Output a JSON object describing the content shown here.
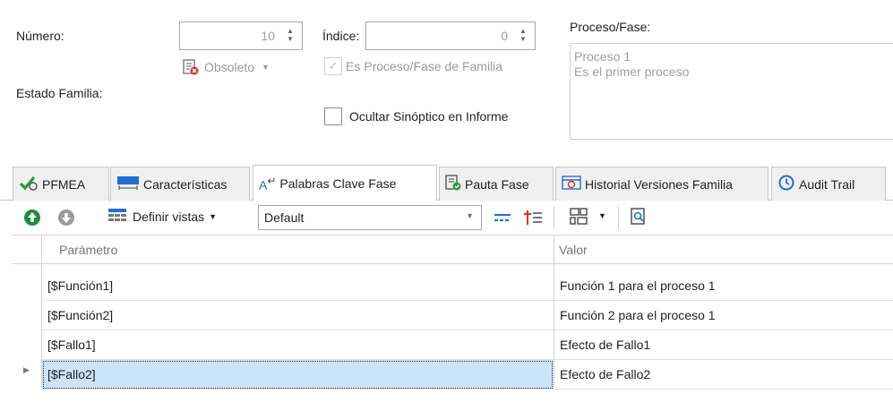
{
  "form": {
    "numero_label": "Número:",
    "numero_value": "10",
    "indice_label": "Índice:",
    "indice_value": "0",
    "estado_value": "Obsoleto",
    "es_proceso_label": "Es Proceso/Fase de Familia",
    "estado_familia_label": "Estado Familia:",
    "ocultar_label": "Ocultar Sinóptico en Informe",
    "proceso_label": "Proceso/Fase:",
    "proceso_line1": "Proceso 1",
    "proceso_line2": "Es el primer proceso"
  },
  "tabs": [
    {
      "label": "PFMEA",
      "icon": "pfmea-icon"
    },
    {
      "label": "Características",
      "icon": "characteristics-icon"
    },
    {
      "label": "Palabras Clave Fase",
      "icon": "keywords-icon",
      "active": true
    },
    {
      "label": "Pauta Fase",
      "icon": "checklist-icon"
    },
    {
      "label": "Historial Versiones Familia",
      "icon": "history-icon"
    },
    {
      "label": "Audit Trail",
      "icon": "audit-trail-icon"
    }
  ],
  "toolbar": {
    "definir_vistas_label": "Definir vistas",
    "view_combo_value": "Default"
  },
  "grid": {
    "headers": [
      "Parámetro",
      "Valor"
    ],
    "rows": [
      {
        "param": "[$Función1]",
        "valor": "Función 1 para el proceso 1"
      },
      {
        "param": "[$Función2]",
        "valor": "Función 2 para el proceso 1"
      },
      {
        "param": "[$Fallo1]",
        "valor": "Efecto de Fallo1"
      },
      {
        "param": "[$Fallo2]",
        "valor": "Efecto de Fallo2"
      }
    ]
  },
  "colors": {
    "selected_row": "#cce4f7",
    "green_up": "#1e8e3e",
    "grey_down": "#9a9a9a",
    "accent_blue": "#1f6fd1"
  }
}
